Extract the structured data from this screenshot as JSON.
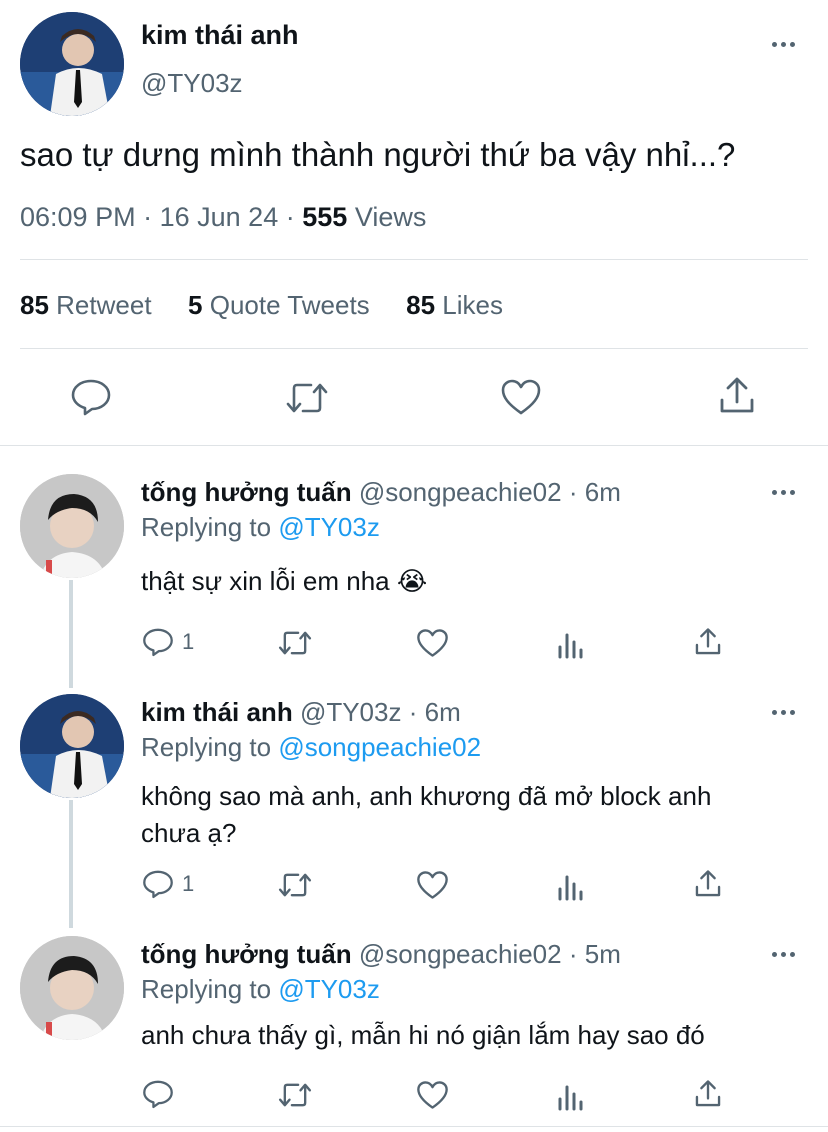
{
  "main_tweet": {
    "display_name": "kim thái anh",
    "handle": "@TY03z",
    "text": "sao tự dưng mình thành người thứ ba vậy nhỉ...?",
    "time": "06:09 PM",
    "date": "16 Jun 24",
    "views_count": "555",
    "views_label": "Views",
    "stats": {
      "retweets_count": "85",
      "retweets_label": "Retweet",
      "quotes_count": "5",
      "quotes_label": "Quote Tweets",
      "likes_count": "85",
      "likes_label": "Likes"
    }
  },
  "replies": [
    {
      "display_name": "tống hưởng tuấn",
      "handle": "@songpeachie02",
      "time": "6m",
      "replying_prefix": "Replying to",
      "replying_to": "@TY03z",
      "text": "thật sự xin lỗi em nha 😭",
      "reply_count": "1"
    },
    {
      "display_name": "kim thái anh",
      "handle": "@TY03z",
      "time": "6m",
      "replying_prefix": "Replying to",
      "replying_to": "@songpeachie02",
      "text_line1": "không sao mà anh, anh khương đã mở block anh",
      "text_line2": "chưa ạ?",
      "reply_count": "1"
    },
    {
      "display_name": "tống hưởng tuấn",
      "handle": "@songpeachie02",
      "time": "5m",
      "replying_prefix": "Replying to",
      "replying_to": "@TY03z",
      "text": "anh chưa thấy gì, mẫn hi nó giận lắm hay sao đó",
      "reply_count": ""
    }
  ],
  "separator": "·",
  "colors": {
    "accent": "#1d9bf0",
    "secondary_text": "#536471",
    "divider": "#dfe3e6"
  }
}
